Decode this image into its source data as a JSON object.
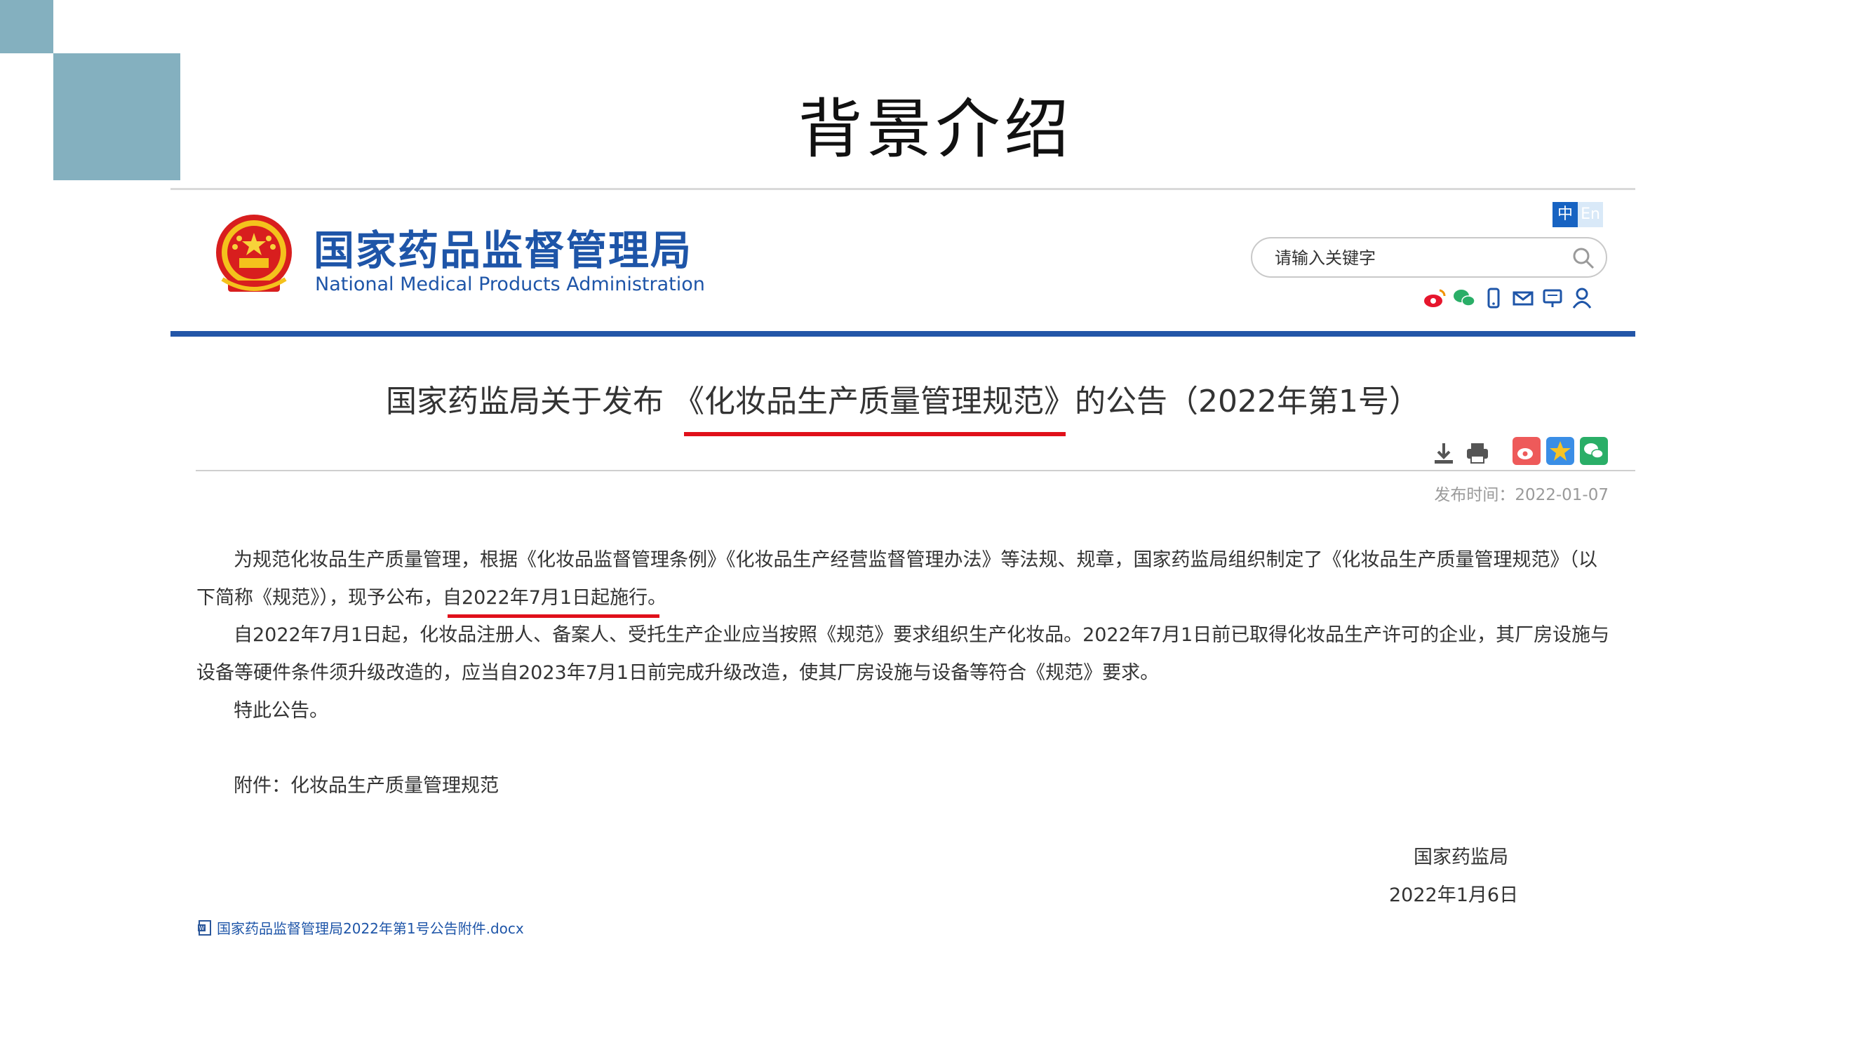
{
  "slide": {
    "title": "背景介绍"
  },
  "site": {
    "name_cn": "国家药品监督管理局",
    "name_en": "National Medical Products Administration",
    "lang_zh": "中",
    "lang_en": "En",
    "search_placeholder": "请输入关键字",
    "social_icons": [
      "weibo-icon",
      "wechat-icon",
      "mobile-icon",
      "mail-icon",
      "feedback-icon",
      "user-icon"
    ]
  },
  "article": {
    "headline": "国家药监局关于发布 《化妆品生产质量管理规范》的公告（2022年第1号）",
    "publish_time": "发布时间：2022-01-07",
    "paragraph1_line1": "为规范化妆品生产质量管理，根据《化妆品监督管理条例》《化妆品生产经营监督管理办法》等法规、规章，国家药监局组织制定了《化妆品生产质量管理规范》（以",
    "paragraph1_line2": "下简称《规范》），现予公布，自2022年7月1日起施行。",
    "paragraph2_line1": "自2022年7月1日起，化妆品注册人、备案人、受托生产企业应当按照《规范》要求组织生产化妆品。2022年7月1日前已取得化妆品生产许可的企业，其厂房设施与",
    "paragraph2_line2": "设备等硬件条件须升级改造的，应当自2023年7月1日前完成升级改造，使其厂房设施与设备等符合《规范》要求。",
    "paragraph3": "特此公告。",
    "attachment_label": "附件：化妆品生产质量管理规范",
    "signature_org": "国家药监局",
    "signature_date": "2022年1月6日",
    "attachment_file": "国家药品监督管理局2022年第1号公告附件.docx"
  },
  "colors": {
    "accent_blue": "#2356a8",
    "highlight_red": "#e0101a",
    "deco_teal": "#84b0bf"
  }
}
